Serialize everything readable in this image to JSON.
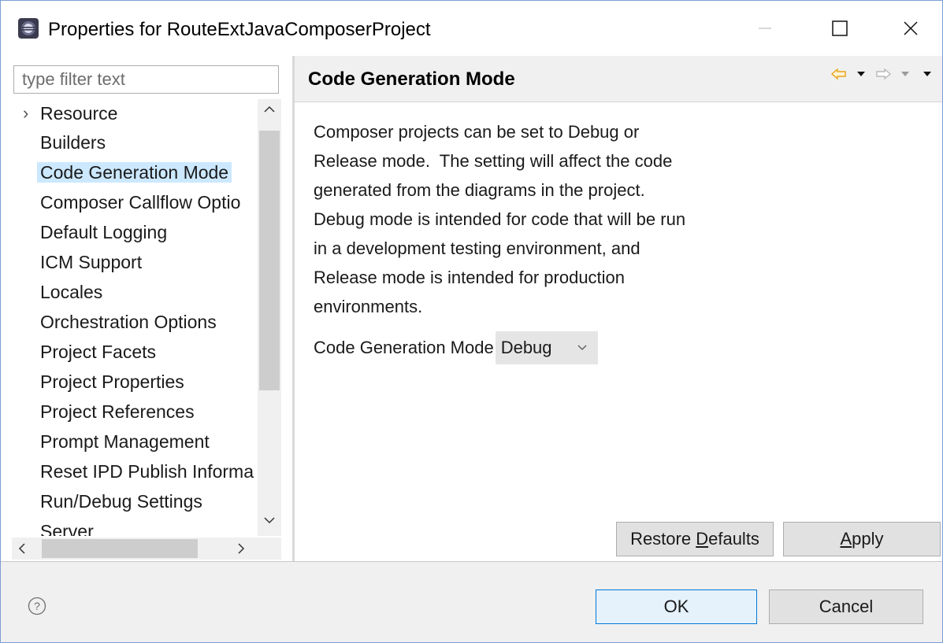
{
  "window": {
    "title": "Properties for RouteExtJavaComposerProject",
    "minimize_icon": "minimize-icon",
    "maximize_icon": "maximize-icon",
    "close_icon": "close-icon"
  },
  "sidebar": {
    "filter_placeholder": "type filter text",
    "items": [
      {
        "label": "Resource",
        "expandable": true
      },
      {
        "label": "Builders"
      },
      {
        "label": "Code Generation Mode",
        "selected": true
      },
      {
        "label": "Composer Callflow Optio"
      },
      {
        "label": "Default Logging"
      },
      {
        "label": "ICM Support"
      },
      {
        "label": "Locales"
      },
      {
        "label": "Orchestration Options"
      },
      {
        "label": "Project Facets"
      },
      {
        "label": "Project Properties"
      },
      {
        "label": "Project References"
      },
      {
        "label": "Prompt Management"
      },
      {
        "label": "Reset IPD Publish Informa"
      },
      {
        "label": "Run/Debug Settings"
      },
      {
        "label": "Server"
      }
    ]
  },
  "page": {
    "title": "Code Generation Mode",
    "description_lines": [
      "Composer projects can be set to Debug or",
      "Release mode.  The setting will affect the code",
      "generated from the diagrams in the project.",
      "Debug mode is intended for code that will be run",
      "in a development testing environment, and",
      "Release mode is intended for production",
      "environments."
    ],
    "mode_label": "Code Generation Mode",
    "mode_value": "Debug",
    "restore_defaults_label_pre": "Restore ",
    "restore_defaults_label_mn": "D",
    "restore_defaults_label_post": "efaults",
    "apply_label_mn": "A",
    "apply_label_post": "pply"
  },
  "footer": {
    "ok_label": "OK",
    "cancel_label": "Cancel"
  },
  "colors": {
    "selection": "#cce8ff",
    "ok_border": "#0078d7",
    "nav_arrow": "#e8a317"
  }
}
